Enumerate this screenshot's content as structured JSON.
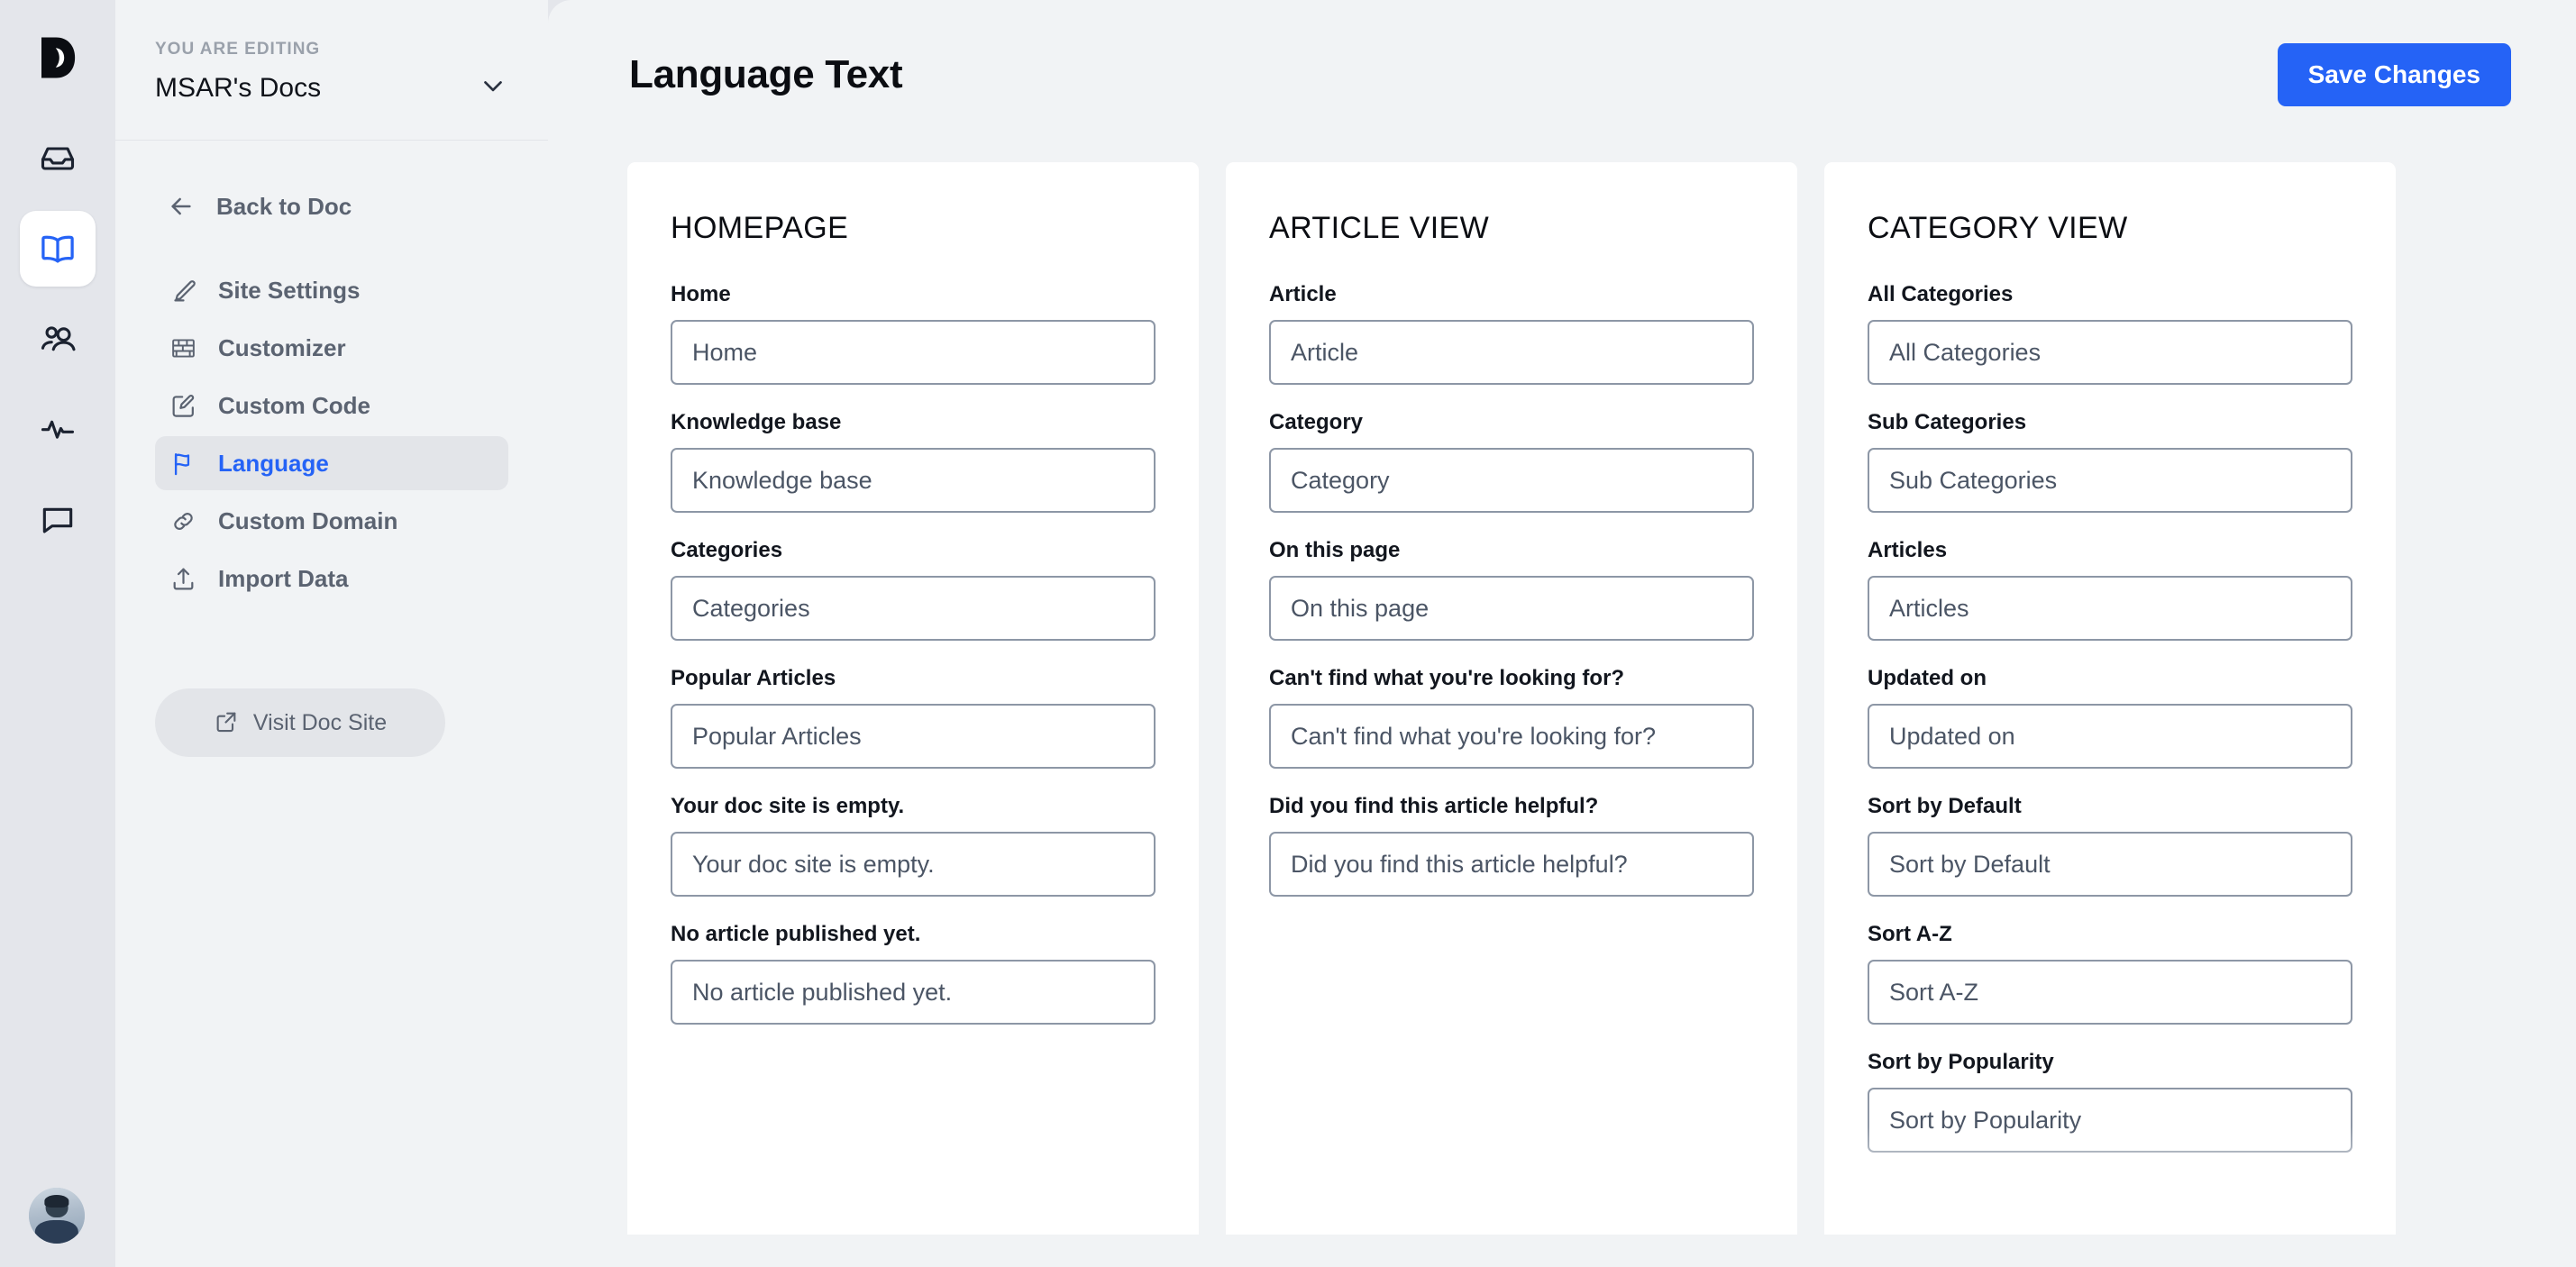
{
  "rail": {
    "logo_icon": "doctor-d-logo-icon",
    "items": [
      {
        "icon": "inbox-icon",
        "name": "inbox",
        "active": false
      },
      {
        "icon": "book-open-icon",
        "name": "docs",
        "active": true
      },
      {
        "icon": "users-icon",
        "name": "contacts",
        "active": false
      },
      {
        "icon": "activity-pulse-icon",
        "name": "activity",
        "active": false
      },
      {
        "icon": "chat-bubble-icon",
        "name": "chat",
        "active": false
      }
    ],
    "avatar_alt": "user-avatar"
  },
  "sidebar": {
    "eyebrow": "YOU ARE EDITING",
    "workspace": "MSAR's Docs",
    "workspace_chevron_icon": "chevron-down-icon",
    "back": {
      "label": "Back to Doc",
      "icon": "arrow-left-icon"
    },
    "items": [
      {
        "label": "Site Settings",
        "icon": "pencil-icon",
        "active": false
      },
      {
        "label": "Customizer",
        "icon": "bricks-icon",
        "active": false
      },
      {
        "label": "Custom Code",
        "icon": "square-pencil-icon",
        "active": false
      },
      {
        "label": "Language",
        "icon": "flag-icon",
        "active": true
      },
      {
        "label": "Custom Domain",
        "icon": "link-icon",
        "active": false
      },
      {
        "label": "Import Data",
        "icon": "upload-icon",
        "active": false
      }
    ],
    "visit": {
      "label": "Visit Doc Site",
      "icon": "external-link-icon"
    }
  },
  "header": {
    "title": "Language Text",
    "save_label": "Save Changes"
  },
  "colors": {
    "accent": "#2563f6",
    "rail_bg": "#e4e6eb",
    "sidebar_bg": "#f1f3f5",
    "card_bg": "#ffffff",
    "input_border": "#8d97a6",
    "input_text": "#4b5565"
  },
  "cards": [
    {
      "title": "HOMEPAGE",
      "fields": [
        {
          "label": "Home",
          "value": "Home"
        },
        {
          "label": "Knowledge base",
          "value": "Knowledge base"
        },
        {
          "label": "Categories",
          "value": "Categories"
        },
        {
          "label": "Popular Articles",
          "value": "Popular Articles"
        },
        {
          "label": "Your doc site is empty.",
          "value": "Your doc site is empty."
        },
        {
          "label": "No article published yet.",
          "value": "No article published yet."
        }
      ]
    },
    {
      "title": "ARTICLE VIEW",
      "fields": [
        {
          "label": "Article",
          "value": "Article"
        },
        {
          "label": "Category",
          "value": "Category"
        },
        {
          "label": "On this page",
          "value": "On this page"
        },
        {
          "label": "Can't find what you're looking for?",
          "value": "Can't find what you're looking for?"
        },
        {
          "label": "Did you find this article helpful?",
          "value": "Did you find this article helpful?"
        }
      ]
    },
    {
      "title": "CATEGORY VIEW",
      "fields": [
        {
          "label": "All Categories",
          "value": "All Categories"
        },
        {
          "label": "Sub Categories",
          "value": "Sub Categories"
        },
        {
          "label": "Articles",
          "value": "Articles"
        },
        {
          "label": "Updated on",
          "value": "Updated on"
        },
        {
          "label": "Sort by Default",
          "value": "Sort by Default"
        },
        {
          "label": "Sort A-Z",
          "value": "Sort A-Z"
        },
        {
          "label": "Sort by Popularity",
          "value": "Sort by Popularity"
        }
      ]
    }
  ]
}
